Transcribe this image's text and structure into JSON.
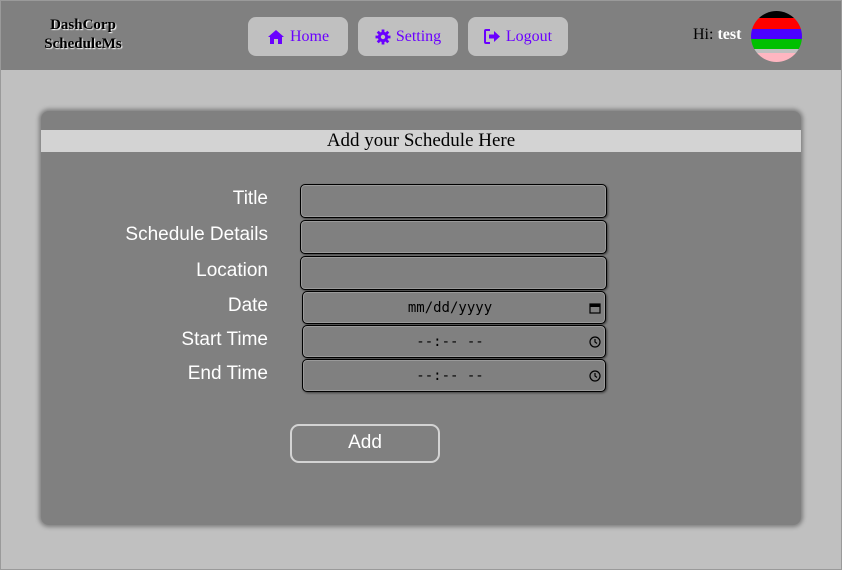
{
  "header": {
    "brand_line1": "DashCorp",
    "brand_line2": "ScheduleMs",
    "nav": [
      {
        "label": "Home",
        "icon": "home-icon"
      },
      {
        "label": "Setting",
        "icon": "gear-icon"
      },
      {
        "label": "Logout",
        "icon": "logout-icon"
      }
    ],
    "greeting_prefix": "Hi:",
    "username": "test",
    "accent_color": "#6a00ff"
  },
  "form": {
    "title": "Add your Schedule Here",
    "fields": [
      {
        "label": "Title",
        "type": "text",
        "value": ""
      },
      {
        "label": "Schedule Details",
        "type": "text",
        "value": ""
      },
      {
        "label": "Location",
        "type": "text",
        "value": ""
      },
      {
        "label": "Date",
        "type": "date",
        "placeholder": "mm/dd/yyyy"
      },
      {
        "label": "Start Time",
        "type": "time",
        "placeholder": "--:-- --"
      },
      {
        "label": "End Time",
        "type": "time",
        "placeholder": "--:-- --"
      }
    ],
    "submit_label": "Add"
  }
}
